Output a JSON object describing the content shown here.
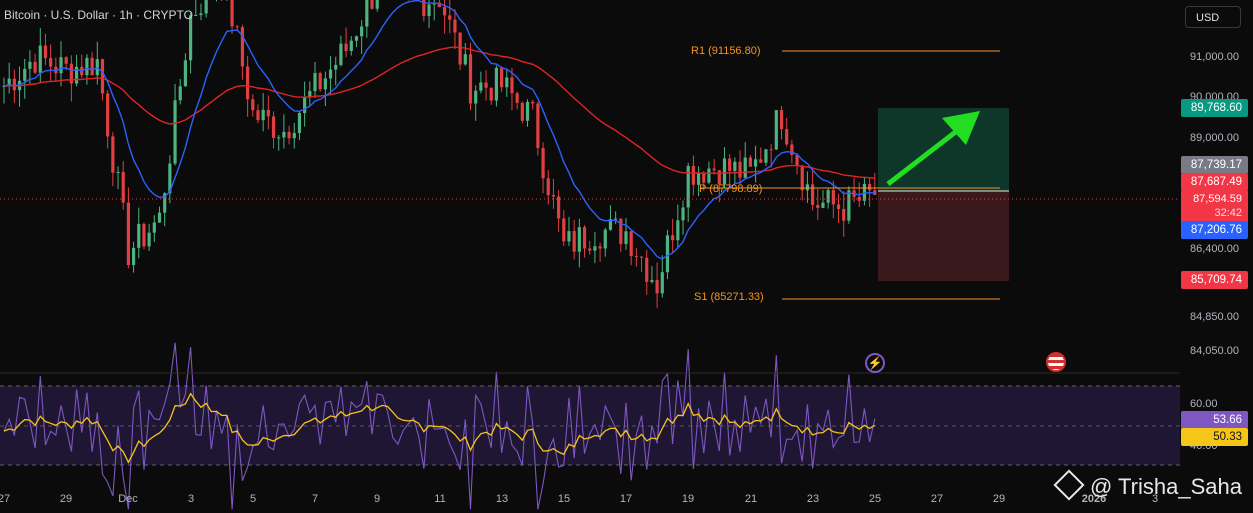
{
  "header": {
    "title": "Bitcoin · U.S. Dollar · 1h · CRYPTO",
    "currency_button": "USD"
  },
  "colors": {
    "background": "#0b0b0c",
    "up_candle": "#4db380",
    "down_candle": "#e04040",
    "ema_red": "#e02424",
    "ema_blue": "#2962ff",
    "level_orange": "#f7931a",
    "rsi_line": "#7e57c2",
    "rsi_signal": "#f5c518",
    "profit_zone": "#0f3a2c",
    "loss_zone": "#3d1a1e",
    "arrow_green": "#22dd22"
  },
  "price_axis": {
    "labels": [
      "91,000.00",
      "90,000.00",
      "89,000.00",
      "86,400.00",
      "84,850.00",
      "84,050.00"
    ],
    "rsi_labels": [
      "60.00",
      "40.00"
    ]
  },
  "price_tags": {
    "target": "89,768.60",
    "grey": "87,739.17",
    "red_top": "87,687.49",
    "current": "87,594.59",
    "countdown": "32:42",
    "blue": "87,206.76",
    "stop": "85,709.74",
    "rsi_value": "53.66",
    "rsi_signal_value": "50.33"
  },
  "levels": {
    "r1": "R1 (91156.80)",
    "pivot": "P (87798.89)",
    "s1": "S1 (85271.33)"
  },
  "time_axis": {
    "labels": [
      "27",
      "29",
      "Dec",
      "3",
      "5",
      "7",
      "9",
      "11",
      "13",
      "15",
      "17",
      "19",
      "21",
      "23",
      "25",
      "27",
      "29",
      "2026",
      "3"
    ]
  },
  "icons": {
    "lightning": "lightning-icon",
    "flag": "us-flag-icon",
    "watermark": "binance-logo-icon"
  },
  "watermark": {
    "text": "@ Trisha_Saha"
  },
  "chart_data": {
    "type": "candlestick",
    "symbol": "Bitcoin · U.S. Dollar · 1h · CRYPTO",
    "x_tick_labels": [
      "27",
      "29",
      "Dec",
      "3",
      "5",
      "7",
      "9",
      "11",
      "13",
      "15",
      "17",
      "19",
      "21",
      "23",
      "25",
      "27",
      "29",
      "2026",
      "3"
    ],
    "y_tick_labels": [
      91000,
      90000,
      89000,
      86400,
      84850,
      84050
    ],
    "visible_low_approx": 84000,
    "current_price": 87594.59,
    "levels": {
      "R1": 91156.8,
      "P": 87798.89,
      "S1": 85271.33
    },
    "trade_setup": {
      "entry": 87687.49,
      "take_profit": 89768.6,
      "stop_loss": 85709.74
    },
    "moving_average_values_shown": [
      87739.17,
      87206.76
    ],
    "daily_closes_approx": [
      {
        "x": "27",
        "close": 90300
      },
      {
        "x": "28",
        "close": 91000
      },
      {
        "x": "29",
        "close": 90700
      },
      {
        "x": "30",
        "close": 90900
      },
      {
        "x": "Dec",
        "close": 86200
      },
      {
        "x": "2",
        "close": 87000
      },
      {
        "x": "3",
        "close": 92000
      },
      {
        "x": "4",
        "close": 93200
      },
      {
        "x": "5",
        "close": 89600
      },
      {
        "x": "6",
        "close": 89200
      },
      {
        "x": "7",
        "close": 90200
      },
      {
        "x": "8",
        "close": 91200
      },
      {
        "x": "9",
        "close": 92800
      },
      {
        "x": "10",
        "close": 92400
      },
      {
        "x": "11",
        "close": 92500
      },
      {
        "x": "12",
        "close": 90300
      },
      {
        "x": "13",
        "close": 90300
      },
      {
        "x": "14",
        "close": 89500
      },
      {
        "x": "15",
        "close": 86300
      },
      {
        "x": "16",
        "close": 86700
      },
      {
        "x": "17",
        "close": 86700
      },
      {
        "x": "18",
        "close": 85400
      },
      {
        "x": "19",
        "close": 88200
      },
      {
        "x": "20",
        "close": 88300
      },
      {
        "x": "21",
        "close": 88100
      },
      {
        "x": "22",
        "close": 89600
      },
      {
        "x": "23",
        "close": 87400
      },
      {
        "x": "24",
        "close": 87300
      },
      {
        "x": "25",
        "close": 87600
      }
    ],
    "rsi": {
      "value": 53.66,
      "signal": 50.33,
      "bands": [
        70,
        50,
        30
      ]
    }
  }
}
